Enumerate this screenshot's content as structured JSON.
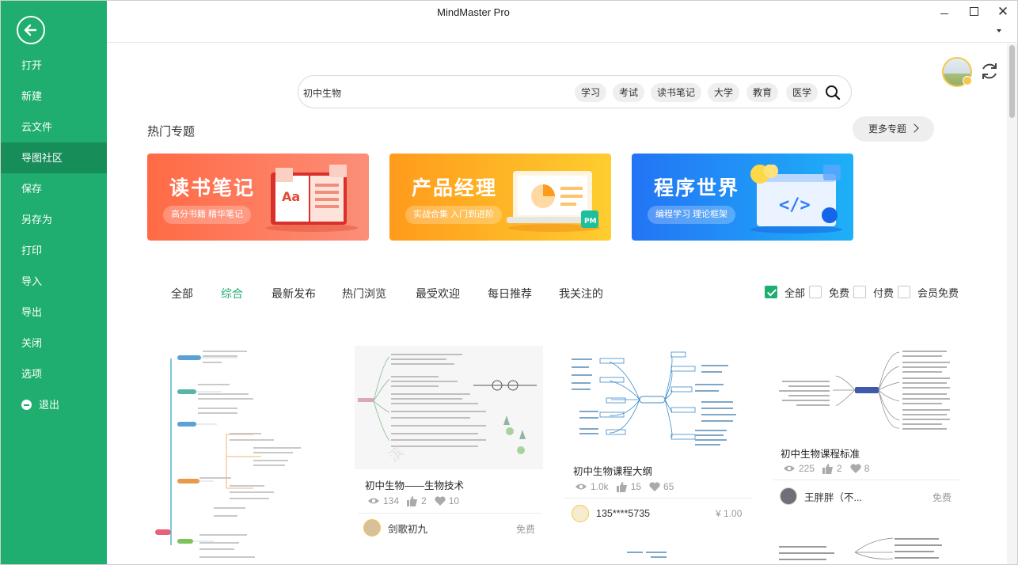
{
  "app": {
    "title": "MindMaster Pro"
  },
  "sidebar": {
    "items": [
      {
        "label": "打开",
        "active": false
      },
      {
        "label": "新建",
        "active": false
      },
      {
        "label": "云文件",
        "active": false
      },
      {
        "label": "导图社区",
        "active": true
      },
      {
        "label": "保存",
        "active": false
      },
      {
        "label": "另存为",
        "active": false
      },
      {
        "label": "打印",
        "active": false
      },
      {
        "label": "导入",
        "active": false
      },
      {
        "label": "导出",
        "active": false
      },
      {
        "label": "关闭",
        "active": false
      },
      {
        "label": "选项",
        "active": false
      },
      {
        "label": "退出",
        "active": false,
        "icon": "minus-circle-icon"
      }
    ]
  },
  "search": {
    "value": "初中生物",
    "tags": [
      "学习",
      "考试",
      "读书笔记",
      "大学",
      "教育",
      "医学"
    ]
  },
  "hot": {
    "title": "热门专题",
    "more": "更多专题",
    "banners": [
      {
        "title": "读书笔记",
        "subtitle": "高分书籍 精华笔记",
        "color": "#ff6a45"
      },
      {
        "title": "产品经理",
        "subtitle": "实战合集 入门到进阶",
        "color": "#ff9b1b",
        "art_label": "PM"
      },
      {
        "title": "程序世界",
        "subtitle": "编程学习 理论框架",
        "color": "#2374f5",
        "art_label": "</>"
      }
    ]
  },
  "tabs": [
    {
      "label": "全部",
      "active": false
    },
    {
      "label": "综合",
      "active": true
    },
    {
      "label": "最新发布",
      "active": false
    },
    {
      "label": "热门浏览",
      "active": false
    },
    {
      "label": "最受欢迎",
      "active": false
    },
    {
      "label": "每日推荐",
      "active": false
    },
    {
      "label": "我关注的",
      "active": false
    }
  ],
  "filters": [
    {
      "label": "全部",
      "checked": true
    },
    {
      "label": "免费",
      "checked": false
    },
    {
      "label": "付费",
      "checked": false
    },
    {
      "label": "会员免费",
      "checked": false
    }
  ],
  "cards": [
    {
      "title": "初中生物——生物技术",
      "views": "134",
      "likes": "2",
      "favorites": "10",
      "author": "剑歌初九",
      "price": "免费"
    },
    {
      "title": "初中生物课程大纲",
      "views": "1.0k",
      "likes": "15",
      "favorites": "65",
      "author": "135****5735",
      "price": "¥ 1.00"
    },
    {
      "title": "初中生物课程标准",
      "views": "225",
      "likes": "2",
      "favorites": "8",
      "author": "王胖胖（不...",
      "price": "免费"
    }
  ],
  "colors": {
    "accent": "#1fae6f",
    "accent_dark": "#178d59"
  }
}
